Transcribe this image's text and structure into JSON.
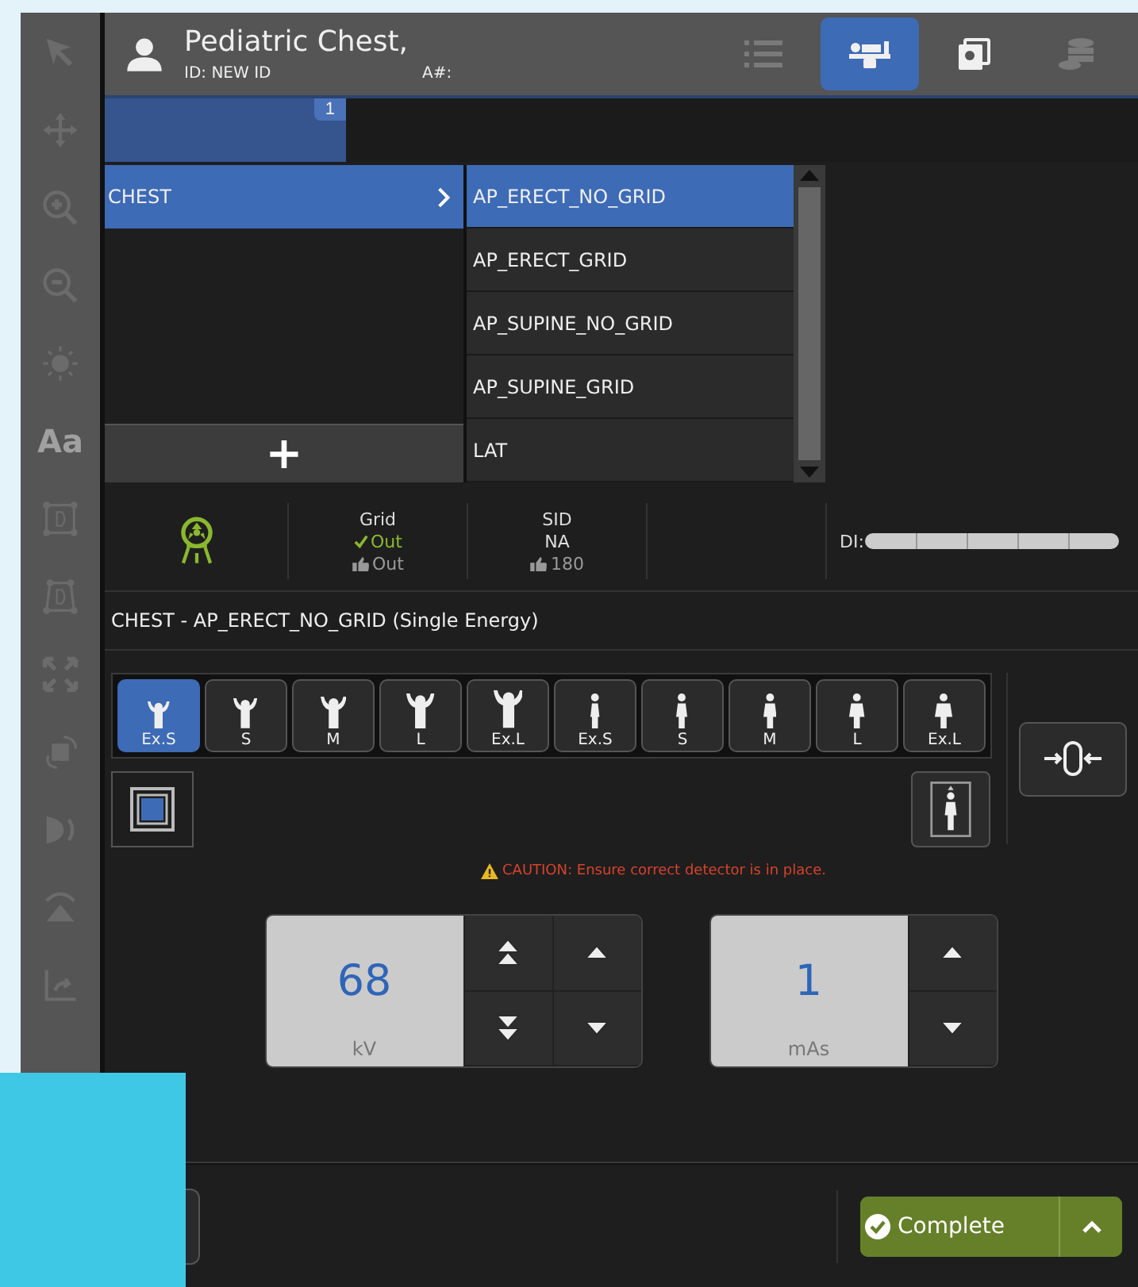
{
  "toolbar": [
    {
      "kind": "pointer"
    },
    {
      "kind": "move"
    },
    {
      "kind": "zoom-in"
    },
    {
      "kind": "zoom-out"
    },
    {
      "kind": "brightness"
    },
    {
      "kind": "text",
      "label": "Aa"
    },
    {
      "kind": "frame"
    },
    {
      "kind": "frame-alt"
    },
    {
      "kind": "expand"
    },
    {
      "kind": "rotate"
    },
    {
      "kind": "flip"
    },
    {
      "kind": "tilt"
    },
    {
      "kind": "export"
    }
  ],
  "patient": {
    "name": "Pediatric Chest,",
    "id": "ID: NEW ID",
    "accession": "A#:"
  },
  "nav_buttons": [
    {
      "kind": "list",
      "selected": false,
      "disabled": true
    },
    {
      "kind": "table",
      "selected": true,
      "disabled": false
    },
    {
      "kind": "images",
      "selected": false,
      "disabled": false
    },
    {
      "kind": "database",
      "selected": false,
      "disabled": true
    }
  ],
  "tabs": [
    {
      "badge": "1",
      "selected": true
    }
  ],
  "categories": [
    {
      "label": "CHEST",
      "selected": true
    }
  ],
  "add_button": "+",
  "views": [
    {
      "label": "AP_ERECT_NO_GRID",
      "selected": true
    },
    {
      "label": "AP_ERECT_GRID",
      "selected": false
    },
    {
      "label": "AP_SUPINE_NO_GRID",
      "selected": false
    },
    {
      "label": "AP_SUPINE_GRID",
      "selected": false
    },
    {
      "label": "LAT",
      "selected": false
    }
  ],
  "grid": {
    "title": "Grid",
    "current": "Out",
    "default": "Out"
  },
  "sid": {
    "title": "SID",
    "current": "NA",
    "default": "180"
  },
  "di": {
    "label": "DI:"
  },
  "procedure": "CHEST - AP_ERECT_NO_GRID (Single Energy)",
  "sizes": [
    {
      "label": "Ex.S",
      "kind": "child",
      "selected": true
    },
    {
      "label": "S",
      "kind": "child",
      "selected": false
    },
    {
      "label": "M",
      "kind": "child",
      "selected": false
    },
    {
      "label": "L",
      "kind": "child",
      "selected": false
    },
    {
      "label": "Ex.L",
      "kind": "child",
      "selected": false
    },
    {
      "label": "Ex.S",
      "kind": "adult",
      "selected": false
    },
    {
      "label": "S",
      "kind": "adult",
      "selected": false
    },
    {
      "label": "M",
      "kind": "adult",
      "selected": false
    },
    {
      "label": "L",
      "kind": "adult",
      "selected": false
    },
    {
      "label": "Ex.L",
      "kind": "adult",
      "selected": false
    }
  ],
  "caution": "CAUTION: Ensure correct detector is in place.",
  "techniques": [
    {
      "value": "68",
      "unit": "kV",
      "kind": "coarse"
    },
    {
      "value": "1",
      "unit": "mAs",
      "kind": "fine"
    }
  ],
  "complete_button": "Complete"
}
